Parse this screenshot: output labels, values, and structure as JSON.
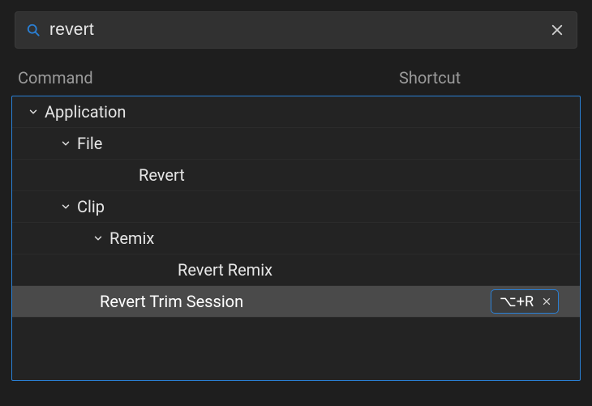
{
  "search": {
    "query": "revert",
    "placeholder": ""
  },
  "headers": {
    "command": "Command",
    "shortcut": "Shortcut"
  },
  "tree": {
    "app": {
      "label": "Application"
    },
    "file": {
      "label": "File"
    },
    "file_revert": {
      "label": "Revert"
    },
    "clip": {
      "label": "Clip"
    },
    "remix": {
      "label": "Remix"
    },
    "revert_remix": {
      "label": "Revert Remix"
    },
    "revert_trim": {
      "label": "Revert Trim Session",
      "shortcut": "⌥+R"
    }
  }
}
